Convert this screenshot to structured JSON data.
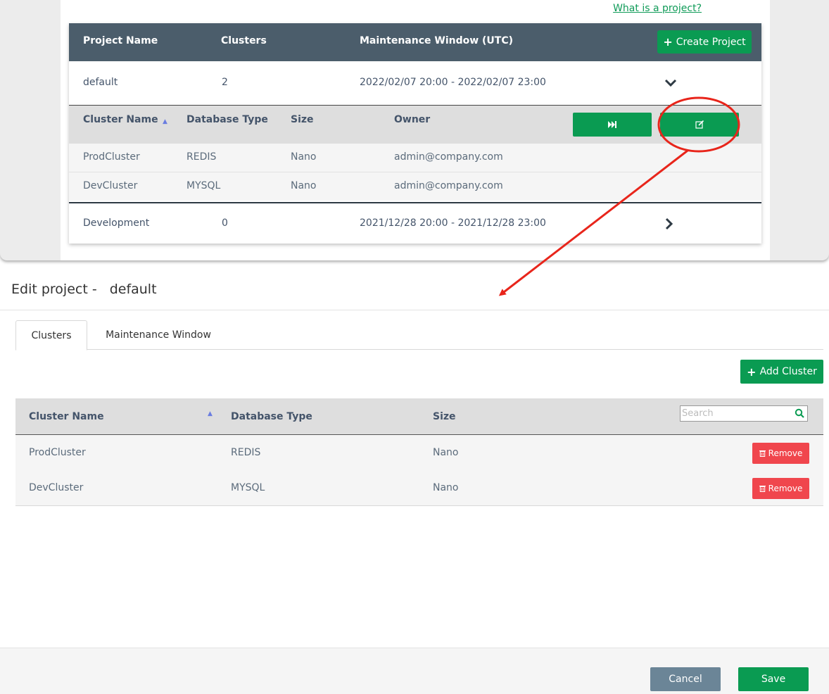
{
  "colors": {
    "accent": "#0a9b52",
    "header": "#4b5d6b",
    "danger": "#f0464d",
    "annotation": "#e8251b",
    "cancel": "#6b8597"
  },
  "top": {
    "help_link": "What is a project?",
    "create_button": "Create Project",
    "columns": {
      "name": "Project Name",
      "clusters": "Clusters",
      "window": "Maintenance Window (UTC)"
    },
    "projects": [
      {
        "name": "default",
        "clusters": "2",
        "window": "2022/02/07 20:00 - 2022/02/07 23:00",
        "expanded": true
      },
      {
        "name": "Development",
        "clusters": "0",
        "window": "2021/12/28 20:00 - 2021/12/28 23:00",
        "expanded": false
      }
    ],
    "sub_columns": {
      "name": "Cluster Name",
      "type": "Database Type",
      "size": "Size",
      "owner": "Owner"
    },
    "sub_rows": [
      {
        "name": "ProdCluster",
        "type": "REDIS",
        "size": "Nano",
        "owner": "admin@company.com"
      },
      {
        "name": "DevCluster",
        "type": "MYSQL",
        "size": "Nano",
        "owner": "admin@company.com"
      }
    ],
    "icons": {
      "skip": "fast-forward-icon",
      "edit": "edit-icon"
    }
  },
  "edit": {
    "title_prefix": "Edit project -",
    "project_name": "default",
    "tabs": [
      {
        "label": "Clusters",
        "active": true
      },
      {
        "label": "Maintenance Window",
        "active": false
      }
    ],
    "add_button": "Add Cluster",
    "columns": {
      "name": "Cluster Name",
      "type": "Database Type",
      "size": "Size"
    },
    "search_placeholder": "Search",
    "rows": [
      {
        "name": "ProdCluster",
        "type": "REDIS",
        "size": "Nano",
        "remove": "Remove"
      },
      {
        "name": "DevCluster",
        "type": "MYSQL",
        "size": "Nano",
        "remove": "Remove"
      }
    ],
    "cancel": "Cancel",
    "save": "Save"
  }
}
